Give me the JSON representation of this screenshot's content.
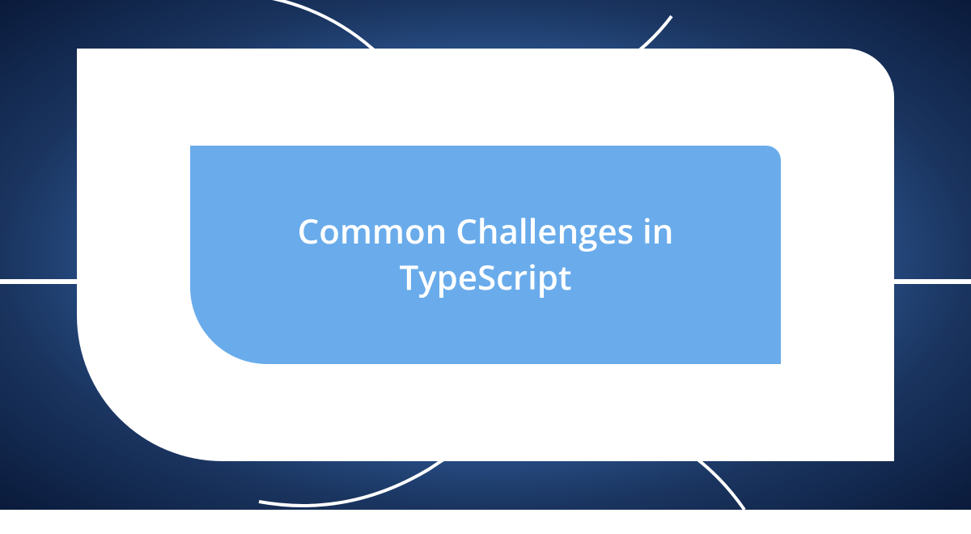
{
  "card": {
    "title": "Common Challenges in TypeScript"
  },
  "colors": {
    "inner_bg": "#6aaceb",
    "outer_bg": "#ffffff",
    "text": "#ffffff"
  }
}
